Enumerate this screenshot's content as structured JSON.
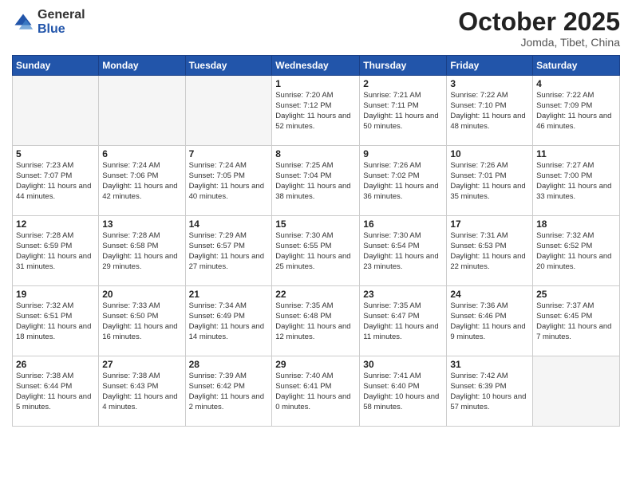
{
  "header": {
    "logo_general": "General",
    "logo_blue": "Blue",
    "month": "October 2025",
    "location": "Jomda, Tibet, China"
  },
  "weekdays": [
    "Sunday",
    "Monday",
    "Tuesday",
    "Wednesday",
    "Thursday",
    "Friday",
    "Saturday"
  ],
  "weeks": [
    [
      {
        "day": "",
        "info": ""
      },
      {
        "day": "",
        "info": ""
      },
      {
        "day": "",
        "info": ""
      },
      {
        "day": "1",
        "info": "Sunrise: 7:20 AM\nSunset: 7:12 PM\nDaylight: 11 hours and 52 minutes."
      },
      {
        "day": "2",
        "info": "Sunrise: 7:21 AM\nSunset: 7:11 PM\nDaylight: 11 hours and 50 minutes."
      },
      {
        "day": "3",
        "info": "Sunrise: 7:22 AM\nSunset: 7:10 PM\nDaylight: 11 hours and 48 minutes."
      },
      {
        "day": "4",
        "info": "Sunrise: 7:22 AM\nSunset: 7:09 PM\nDaylight: 11 hours and 46 minutes."
      }
    ],
    [
      {
        "day": "5",
        "info": "Sunrise: 7:23 AM\nSunset: 7:07 PM\nDaylight: 11 hours and 44 minutes."
      },
      {
        "day": "6",
        "info": "Sunrise: 7:24 AM\nSunset: 7:06 PM\nDaylight: 11 hours and 42 minutes."
      },
      {
        "day": "7",
        "info": "Sunrise: 7:24 AM\nSunset: 7:05 PM\nDaylight: 11 hours and 40 minutes."
      },
      {
        "day": "8",
        "info": "Sunrise: 7:25 AM\nSunset: 7:04 PM\nDaylight: 11 hours and 38 minutes."
      },
      {
        "day": "9",
        "info": "Sunrise: 7:26 AM\nSunset: 7:02 PM\nDaylight: 11 hours and 36 minutes."
      },
      {
        "day": "10",
        "info": "Sunrise: 7:26 AM\nSunset: 7:01 PM\nDaylight: 11 hours and 35 minutes."
      },
      {
        "day": "11",
        "info": "Sunrise: 7:27 AM\nSunset: 7:00 PM\nDaylight: 11 hours and 33 minutes."
      }
    ],
    [
      {
        "day": "12",
        "info": "Sunrise: 7:28 AM\nSunset: 6:59 PM\nDaylight: 11 hours and 31 minutes."
      },
      {
        "day": "13",
        "info": "Sunrise: 7:28 AM\nSunset: 6:58 PM\nDaylight: 11 hours and 29 minutes."
      },
      {
        "day": "14",
        "info": "Sunrise: 7:29 AM\nSunset: 6:57 PM\nDaylight: 11 hours and 27 minutes."
      },
      {
        "day": "15",
        "info": "Sunrise: 7:30 AM\nSunset: 6:55 PM\nDaylight: 11 hours and 25 minutes."
      },
      {
        "day": "16",
        "info": "Sunrise: 7:30 AM\nSunset: 6:54 PM\nDaylight: 11 hours and 23 minutes."
      },
      {
        "day": "17",
        "info": "Sunrise: 7:31 AM\nSunset: 6:53 PM\nDaylight: 11 hours and 22 minutes."
      },
      {
        "day": "18",
        "info": "Sunrise: 7:32 AM\nSunset: 6:52 PM\nDaylight: 11 hours and 20 minutes."
      }
    ],
    [
      {
        "day": "19",
        "info": "Sunrise: 7:32 AM\nSunset: 6:51 PM\nDaylight: 11 hours and 18 minutes."
      },
      {
        "day": "20",
        "info": "Sunrise: 7:33 AM\nSunset: 6:50 PM\nDaylight: 11 hours and 16 minutes."
      },
      {
        "day": "21",
        "info": "Sunrise: 7:34 AM\nSunset: 6:49 PM\nDaylight: 11 hours and 14 minutes."
      },
      {
        "day": "22",
        "info": "Sunrise: 7:35 AM\nSunset: 6:48 PM\nDaylight: 11 hours and 12 minutes."
      },
      {
        "day": "23",
        "info": "Sunrise: 7:35 AM\nSunset: 6:47 PM\nDaylight: 11 hours and 11 minutes."
      },
      {
        "day": "24",
        "info": "Sunrise: 7:36 AM\nSunset: 6:46 PM\nDaylight: 11 hours and 9 minutes."
      },
      {
        "day": "25",
        "info": "Sunrise: 7:37 AM\nSunset: 6:45 PM\nDaylight: 11 hours and 7 minutes."
      }
    ],
    [
      {
        "day": "26",
        "info": "Sunrise: 7:38 AM\nSunset: 6:44 PM\nDaylight: 11 hours and 5 minutes."
      },
      {
        "day": "27",
        "info": "Sunrise: 7:38 AM\nSunset: 6:43 PM\nDaylight: 11 hours and 4 minutes."
      },
      {
        "day": "28",
        "info": "Sunrise: 7:39 AM\nSunset: 6:42 PM\nDaylight: 11 hours and 2 minutes."
      },
      {
        "day": "29",
        "info": "Sunrise: 7:40 AM\nSunset: 6:41 PM\nDaylight: 11 hours and 0 minutes."
      },
      {
        "day": "30",
        "info": "Sunrise: 7:41 AM\nSunset: 6:40 PM\nDaylight: 10 hours and 58 minutes."
      },
      {
        "day": "31",
        "info": "Sunrise: 7:42 AM\nSunset: 6:39 PM\nDaylight: 10 hours and 57 minutes."
      },
      {
        "day": "",
        "info": ""
      }
    ]
  ]
}
